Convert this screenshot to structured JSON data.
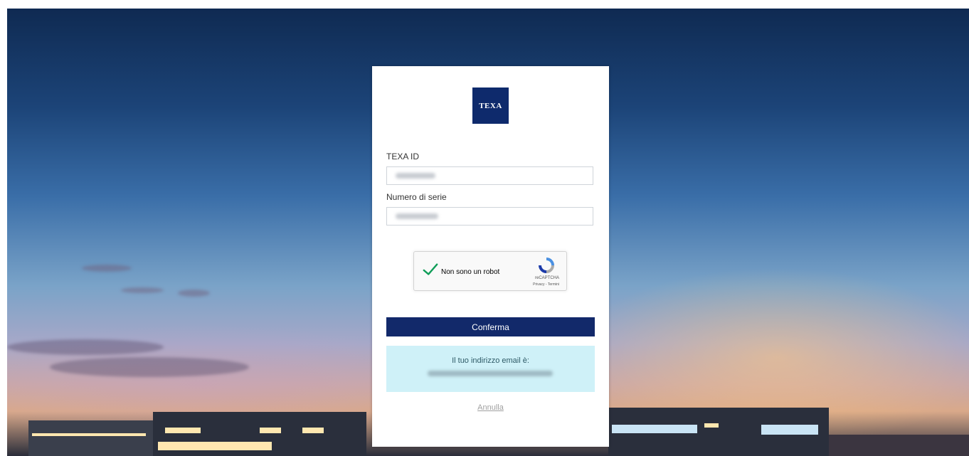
{
  "brand": {
    "logo_text": "TEXA",
    "color": "#0e2a6c"
  },
  "form": {
    "texa_id_label": "TEXA ID",
    "texa_id_value": "",
    "serial_label": "Numero di serie",
    "serial_value": ""
  },
  "captcha": {
    "label": "Non sono un robot",
    "brand": "reCAPTCHA",
    "links": "Privacy - Termini",
    "checked": true,
    "check_color": "#0f9d58"
  },
  "actions": {
    "confirm_label": "Conferma",
    "cancel_label": "Annulla",
    "confirm_color": "#12296a"
  },
  "info": {
    "title": "Il tuo indirizzo email è:",
    "email_masked": "",
    "background": "#cff1f8"
  }
}
